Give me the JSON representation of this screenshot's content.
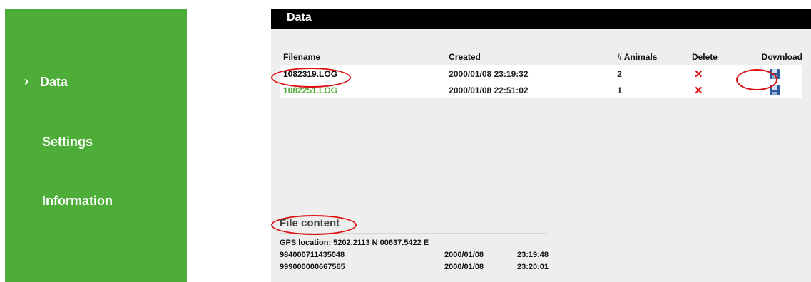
{
  "sidebar": {
    "items": [
      {
        "label": "Data",
        "active": true,
        "indicator": "›"
      },
      {
        "label": "Settings",
        "active": false
      },
      {
        "label": "Information",
        "active": false
      }
    ],
    "color": "#4ead38"
  },
  "main": {
    "title": "Data",
    "table": {
      "columns": [
        "Filename",
        "Created",
        "# Animals",
        "Delete",
        "Download"
      ],
      "rows": [
        {
          "filename": "1082319.LOG",
          "created": "2000/01/08 23:19:32",
          "animals": "2",
          "delete_icon": "x-icon",
          "download_icon": "floppy-disk-icon"
        },
        {
          "filename": "1082251.LOG",
          "created": "2000/01/08 22:51:02",
          "animals": "1",
          "delete_icon": "x-icon",
          "download_icon": "floppy-disk-icon"
        }
      ]
    },
    "file_content": {
      "title": "File content",
      "gps": "GPS location: 5202.2113 N 00637.5422 E",
      "entries": [
        {
          "id": "984000711435048",
          "date": "2000/01/08",
          "time": "23:19:48"
        },
        {
          "id": "999000000667565",
          "date": "2000/01/08",
          "time": "23:20:01"
        }
      ]
    }
  },
  "colors": {
    "accent": "#4ead38",
    "annotation": "#dd1111"
  }
}
